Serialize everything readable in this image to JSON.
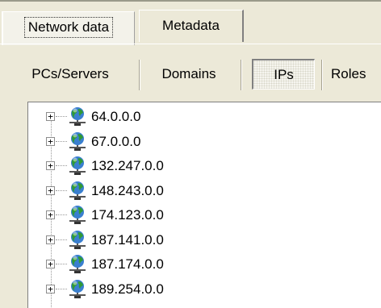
{
  "tabs": [
    {
      "label": "Network data",
      "active": true
    },
    {
      "label": "Metadata",
      "active": false
    }
  ],
  "categories": [
    {
      "label": "PCs/Servers",
      "pressed": false
    },
    {
      "label": "Domains",
      "pressed": false
    },
    {
      "label": "IPs",
      "pressed": true
    },
    {
      "label": "Roles",
      "pressed": false
    }
  ],
  "tree": {
    "icon": "network-globe-icon",
    "expander_symbol": "+",
    "nodes": [
      {
        "label": "64.0.0.0"
      },
      {
        "label": "67.0.0.0"
      },
      {
        "label": "132.247.0.0"
      },
      {
        "label": "148.243.0.0"
      },
      {
        "label": "174.123.0.0"
      },
      {
        "label": "187.141.0.0"
      },
      {
        "label": "187.174.0.0"
      },
      {
        "label": "189.254.0.0"
      }
    ]
  },
  "colors": {
    "window_bg": "#ece9d8",
    "tree_bg": "#ffffff",
    "globe_green": "#2f9a35",
    "globe_blue": "#3a7fd0"
  }
}
